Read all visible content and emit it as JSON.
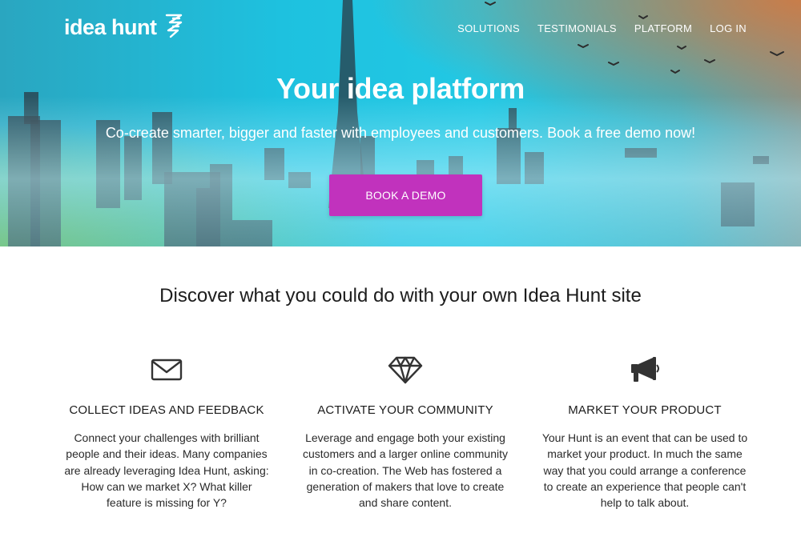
{
  "brand": {
    "name": "idea hunt",
    "icon": "lightning-bolt-logo-icon"
  },
  "nav": {
    "items": [
      {
        "label": "SOLUTIONS"
      },
      {
        "label": "TESTIMONIALS"
      },
      {
        "label": "PLATFORM"
      },
      {
        "label": "LOG IN"
      }
    ]
  },
  "hero": {
    "title": "Your idea platform",
    "subtitle": "Co-create smarter, bigger and faster with employees and customers. Book a free demo now!",
    "cta_label": "BOOK A DEMO"
  },
  "section": {
    "title": "Discover what you could do with your own Idea Hunt site",
    "features": [
      {
        "icon": "envelope-icon",
        "title": "COLLECT IDEAS AND FEEDBACK",
        "body": "Connect your challenges with brilliant people and their ideas. Many companies are already leveraging Idea Hunt, asking: How can we market X? What killer feature is missing for Y?"
      },
      {
        "icon": "diamond-icon",
        "title": "ACTIVATE YOUR COMMUNITY",
        "body": "Leverage and engage both your existing customers and a larger online community in co-creation. The Web has fostered a generation of makers that love to create and share content."
      },
      {
        "icon": "megaphone-icon",
        "title": "MARKET YOUR PRODUCT",
        "body": "Your Hunt is an event that can be used to market your product. In much the same way that you could arrange a conference to create an experience that people can't help to talk about."
      }
    ]
  },
  "colors": {
    "cta": "#c132bd",
    "hero_teal": "#1ec1df",
    "hero_orange": "#d6783c",
    "hero_green": "#6eb93c"
  }
}
